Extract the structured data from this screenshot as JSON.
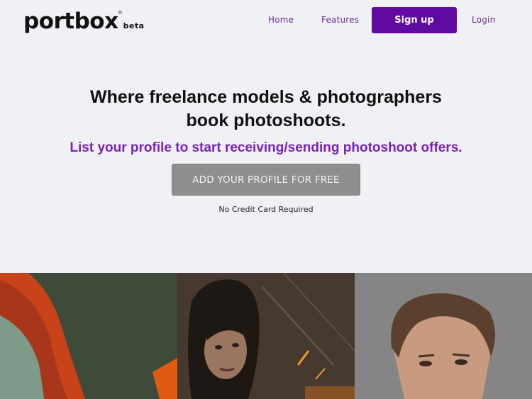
{
  "brand": {
    "name": "portbox",
    "reg_mark": "®",
    "tag": "beta"
  },
  "nav": {
    "home": "Home",
    "features": "Features",
    "signup": "Sign up",
    "login": "Login"
  },
  "hero": {
    "title_line1": "Where freelance models & photographers",
    "title_line2": "book photoshoots.",
    "subtitle": "List your profile to start receiving/sending photoshoot offers.",
    "cta": "ADD YOUR PROFILE FOR FREE",
    "note": "No Credit Card Required"
  },
  "colors": {
    "accent": "#5f0aa0",
    "subtitle": "#7a1fb8",
    "background": "#f0f1f5",
    "cta": "#8e8e8e"
  }
}
